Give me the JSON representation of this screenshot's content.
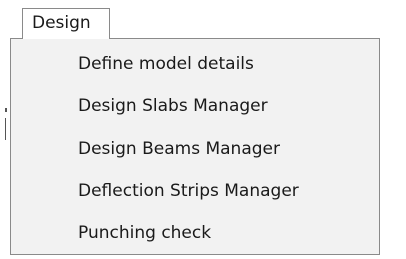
{
  "menu": {
    "title": "Design",
    "items": [
      {
        "label": "Define model details"
      },
      {
        "label": "Design Slabs Manager"
      },
      {
        "label": "Design Beams Manager"
      },
      {
        "label": "Deflection Strips Manager"
      },
      {
        "label": "Punching check"
      }
    ]
  },
  "colors": {
    "menu_background": "#f2f2f2",
    "border": "#8a8a8a",
    "text": "#1a1a1a"
  }
}
